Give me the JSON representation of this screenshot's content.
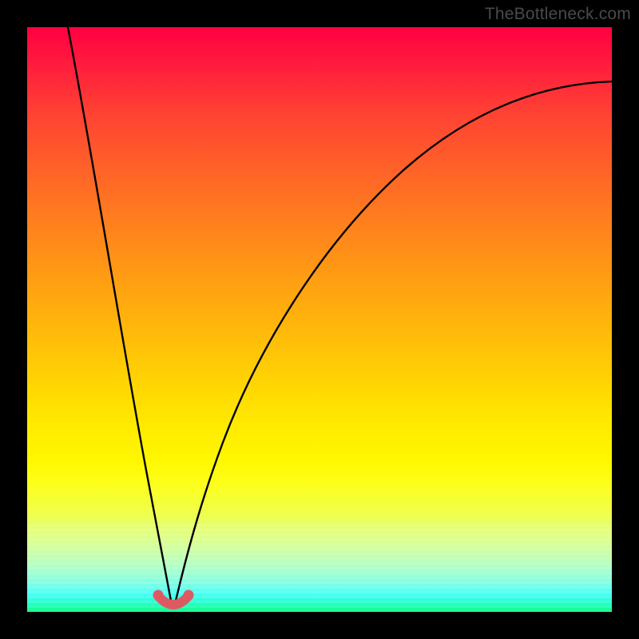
{
  "watermark": "TheBottleneck.com",
  "chart_data": {
    "type": "line",
    "title": "",
    "xlabel": "",
    "ylabel": "",
    "xlim": [
      0,
      100
    ],
    "ylim": [
      0,
      100
    ],
    "grid": false,
    "series": [
      {
        "name": "bottleneck-curve",
        "x": [
          0,
          5,
          10,
          15,
          18,
          20,
          22,
          23.5,
          25,
          26.5,
          28,
          30,
          34,
          40,
          48,
          58,
          70,
          85,
          100
        ],
        "values": [
          100,
          80,
          58,
          35,
          18,
          8,
          2,
          0.5,
          0,
          0.5,
          2,
          7,
          18,
          35,
          52,
          67,
          78,
          86,
          91
        ]
      },
      {
        "name": "highlight-segment",
        "x": [
          22.5,
          23.5,
          25,
          26.5,
          27.5
        ],
        "values": [
          1.7,
          0.6,
          0.2,
          0.6,
          1.7
        ]
      }
    ],
    "colors": {
      "curve": "#000000",
      "highlight": "#de5a63",
      "gradient_top": "#ff0041",
      "gradient_bottom": "#00ff7a"
    }
  }
}
